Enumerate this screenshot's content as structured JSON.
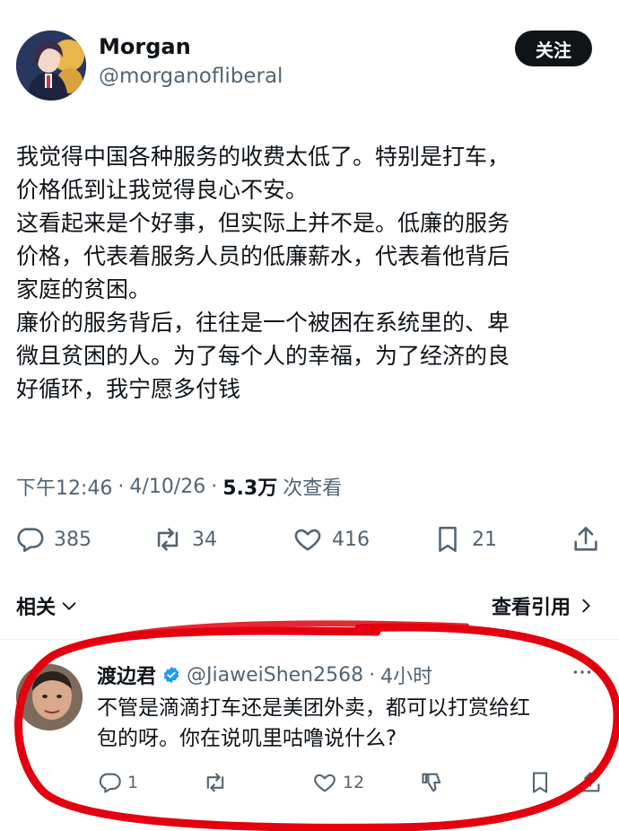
{
  "tweet": {
    "display_name": "Morgan",
    "handle": "@morganofliberal",
    "follow_label": "关注",
    "text": "我觉得中国各种服务的收费太低了。特别是打车，\n价格低到让我觉得良心不安。\n这看起来是个好事，但实际上并不是。低廉的服务\n价格，代表着服务人员的低廉薪水，代表着他背后\n家庭的贫困。\n廉价的服务背后，往往是一个被困在系统里的、卑\n微且贫困的人。为了每个人的幸福，为了经济的良\n好循环，我宁愿多付钱",
    "time": "下午12:46",
    "separator": "·",
    "date": "4/10/26",
    "views_count": "5.3万",
    "views_label": "次查看",
    "stats": {
      "replies": "385",
      "retweets": "34",
      "likes": "416",
      "bookmarks": "21"
    }
  },
  "related_label": "相关",
  "quotes_label": "查看引用",
  "reply": {
    "display_name": "渡边君",
    "handle": "@JiaweiShen2568",
    "separator": "·",
    "time": "4小时",
    "text": "不管是滴滴打车还是美团外卖，都可以打赏给红\n包的呀。你在说叽里咕噜说什么?",
    "stats": {
      "replies": "1",
      "likes": "12"
    }
  },
  "colors": {
    "text": "#0f1419",
    "secondary": "#536471",
    "verified": "#1d9bf0",
    "annotation": "#e3000f"
  },
  "icons": [
    "reply-icon",
    "retweet-icon",
    "like-icon",
    "bookmark-icon",
    "share-icon",
    "dislike-icon",
    "verified-icon",
    "chevron-down-icon",
    "chevron-right-icon",
    "more-icon"
  ]
}
